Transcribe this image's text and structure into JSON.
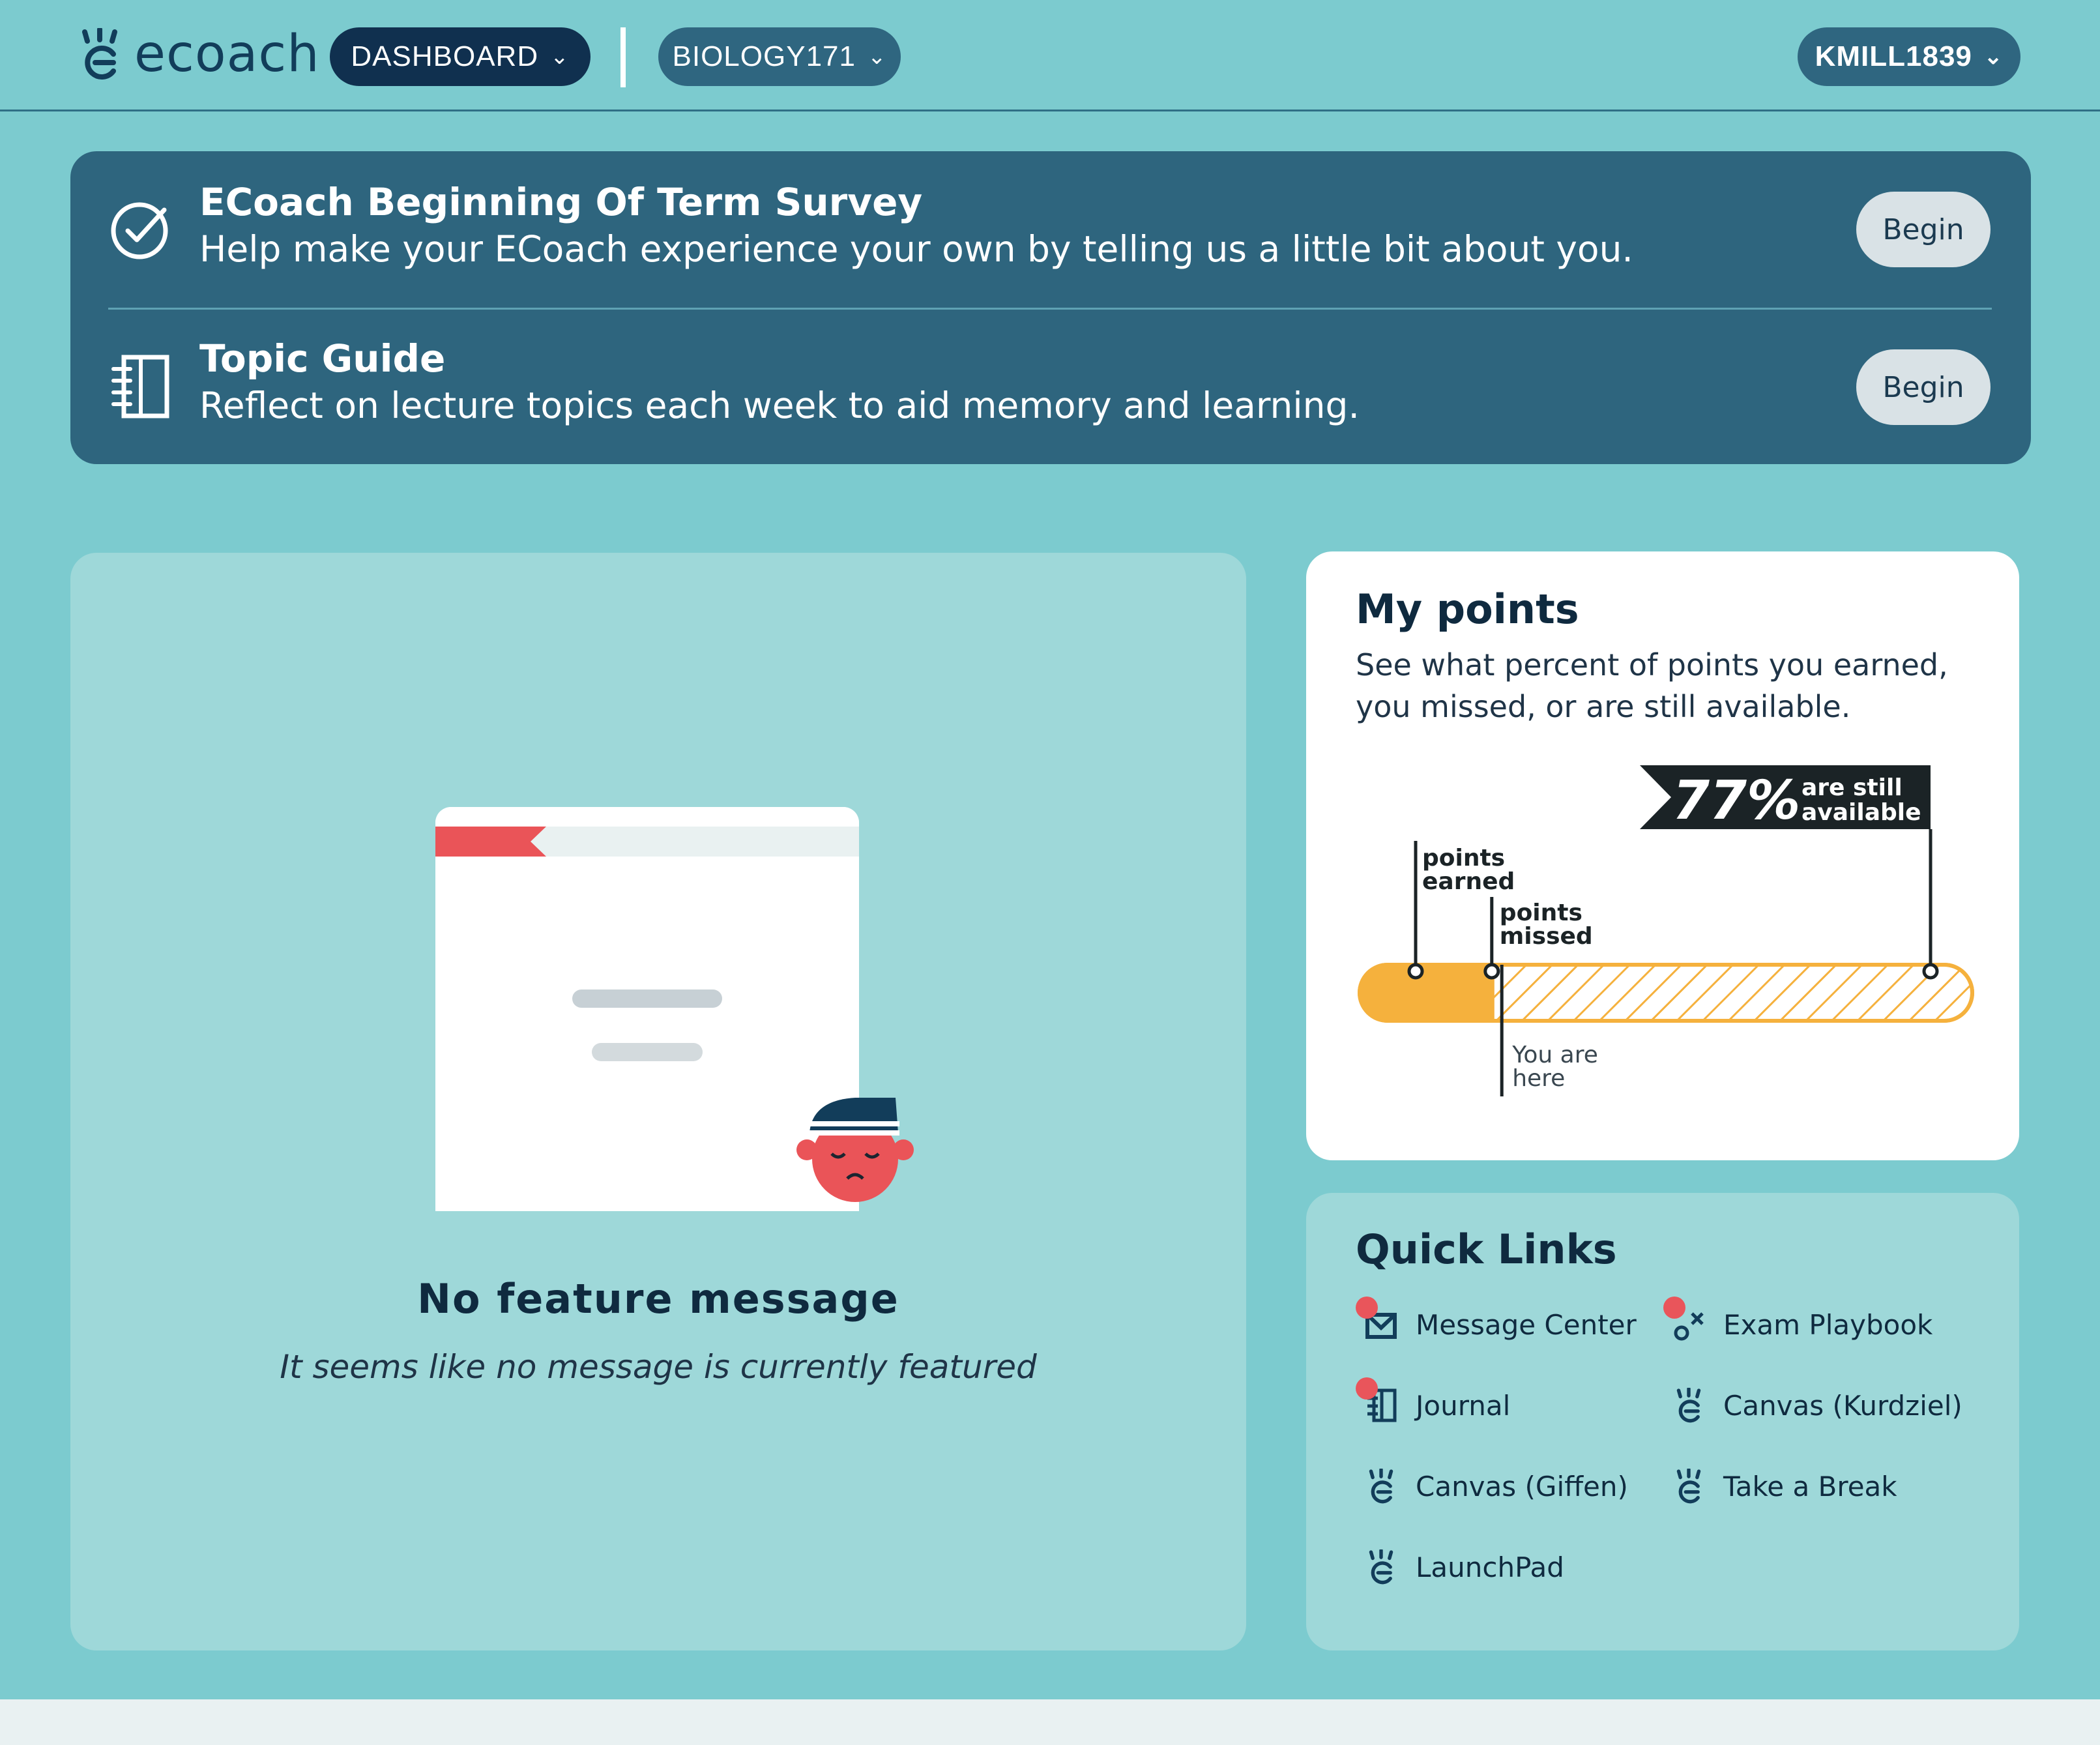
{
  "app": {
    "logo_text": "ecoach"
  },
  "nav": {
    "dashboard_label": "DASHBOARD",
    "course_label": "BIOLOGY171",
    "user_label": "KMILL1839"
  },
  "tasks": [
    {
      "title": "ECoach Beginning Of Term Survey",
      "description": "Help make your ECoach experience your own by telling us a little bit about you.",
      "button": "Begin",
      "icon": "check-circle-icon"
    },
    {
      "title": "Topic Guide",
      "description": "Reflect on lecture topics each week to aid memory and learning.",
      "button": "Begin",
      "icon": "notebook-icon"
    }
  ],
  "feature": {
    "title": "No feature message",
    "subtitle": "It seems like no message is currently featured"
  },
  "points": {
    "title": "My points",
    "description": "See what percent of points you earned, you missed, or are still available.",
    "available_percent_label": "77%",
    "available_text_1": "are still",
    "available_text_2": "available",
    "earned_label_1": "points",
    "earned_label_2": "earned",
    "missed_label_1": "points",
    "missed_label_2": "missed",
    "you_are_here_1": "You are",
    "you_are_here_2": "here",
    "earned_fraction": 0.22,
    "missed_fraction": 0.01,
    "available_fraction": 0.77
  },
  "quick_links": {
    "title": "Quick Links",
    "items": [
      {
        "label": "Message Center",
        "icon": "envelope-icon",
        "notification": true
      },
      {
        "label": "Exam Playbook",
        "icon": "playbook-icon",
        "notification": true
      },
      {
        "label": "Journal",
        "icon": "journal-icon",
        "notification": true
      },
      {
        "label": "Canvas (Kurdziel)",
        "icon": "ecoach-logo-icon",
        "notification": false
      },
      {
        "label": "Canvas (Giffen)",
        "icon": "ecoach-logo-icon",
        "notification": false
      },
      {
        "label": "Take a Break",
        "icon": "ecoach-logo-icon",
        "notification": false
      },
      {
        "label": "LaunchPad",
        "icon": "ecoach-logo-icon",
        "notification": false
      }
    ]
  },
  "colors": {
    "background": "#7ccbcf",
    "dark_navy": "#10304f",
    "card_blue": "#2e657e",
    "accent_orange": "#f5b13d",
    "alert_red": "#e9555b"
  }
}
